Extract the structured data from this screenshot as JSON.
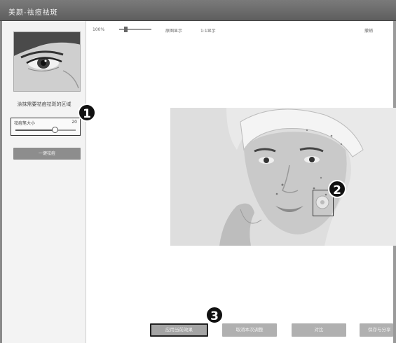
{
  "window": {
    "title": "美颜-祛痘祛斑"
  },
  "sidebar": {
    "hint": "涂抹需要祛痘祛斑的区域",
    "brush": {
      "label": "祛痘笔大小",
      "value": "20",
      "level": 0.65
    },
    "one_click_label": "一键祛痘"
  },
  "toolbar": {
    "zoom": "100%",
    "tool1": "原图显示",
    "tool2": "1:1显示",
    "tool3": "撤销"
  },
  "annotations": [
    "1",
    "2",
    "3"
  ],
  "buttons": {
    "apply": "应用当前效果",
    "cancel": "取消本次调整",
    "compare": "对比",
    "save": "保存与分享"
  }
}
